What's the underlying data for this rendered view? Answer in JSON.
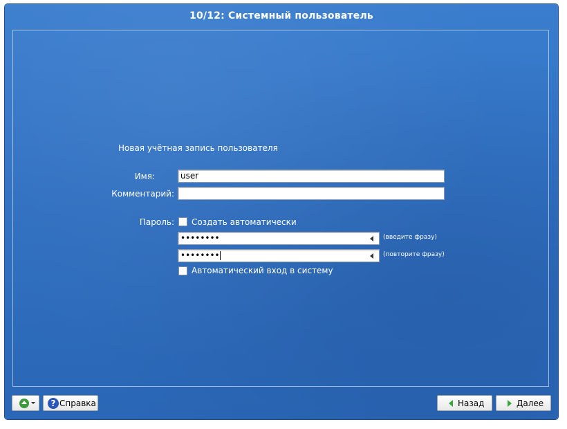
{
  "window": {
    "title": "10/12: Системный пользователь"
  },
  "form": {
    "section_title": "Новая учётная запись пользователя",
    "name_label": "Имя:",
    "name_value": "user",
    "comment_label": "Комментарий:",
    "comment_value": "",
    "password_label": "Пароль:",
    "auto_create_label": "Создать автоматически",
    "auto_create_checked": false,
    "password_value_masked": "••••••••",
    "password_hint": "(введите фразу)",
    "password_repeat_masked": "••••••••",
    "password_repeat_hint": "(повторите фразу)",
    "autologin_label": "Автоматический вход в систему",
    "autologin_checked": false
  },
  "footer": {
    "help_label": "Справка",
    "back_label": "Назад",
    "next_label": "Далее"
  },
  "icons": {
    "up": "up-arrow-icon",
    "help": "help-icon",
    "back": "arrow-left-icon",
    "next": "arrow-right-icon",
    "caps": "caps-lock-indicator-icon"
  },
  "colors": {
    "background": "#2f6fc0",
    "accent_green": "#3aa53a"
  }
}
